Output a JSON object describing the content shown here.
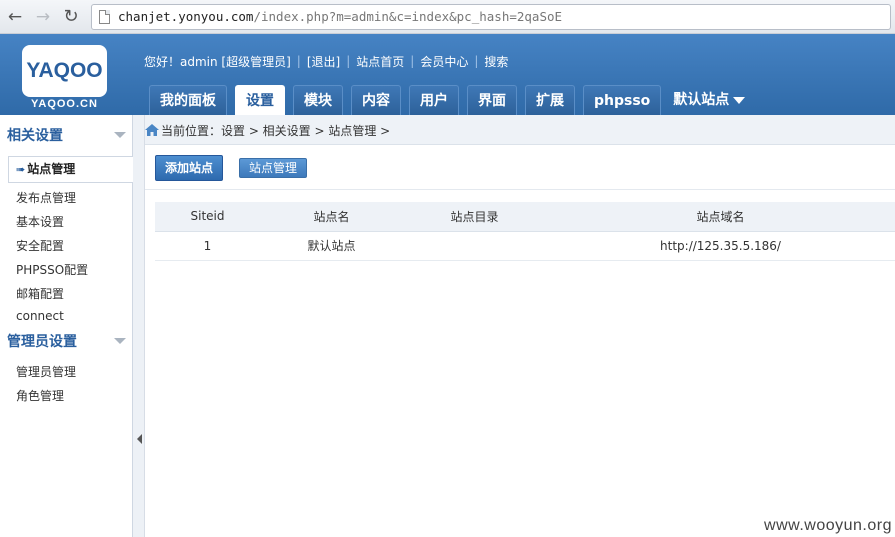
{
  "browser": {
    "url_host": "chanjet.yonyou.com",
    "url_path": "/index.php?m=admin&c=index&pc_hash=2qaSoE"
  },
  "header": {
    "logo_text": "YAQOO",
    "logo_sub": "YAQOO.CN",
    "greeting": "您好！admin [超级管理员]",
    "logout": "[退出]",
    "site_home": "站点首页",
    "member_center": "会员中心",
    "search": "搜索"
  },
  "tabs": [
    {
      "label": "我的面板"
    },
    {
      "label": "设置"
    },
    {
      "label": "模块"
    },
    {
      "label": "内容"
    },
    {
      "label": "用户"
    },
    {
      "label": "界面"
    },
    {
      "label": "扩展"
    },
    {
      "label": "phpsso"
    }
  ],
  "site_switch": "默认站点",
  "sidebar": {
    "group1_title": "相关设置",
    "group1_items": [
      "站点管理",
      "发布点管理",
      "基本设置",
      "安全配置",
      "PHPSSO配置",
      "邮箱配置",
      "connect"
    ],
    "group2_title": "管理员设置",
    "group2_items": [
      "管理员管理",
      "角色管理"
    ]
  },
  "breadcrumb": "当前位置：设置 > 相关设置 > 站点管理 >",
  "actions": {
    "add_site": "添加站点",
    "site_manage": "站点管理"
  },
  "table": {
    "headers": [
      "Siteid",
      "站点名",
      "站点目录",
      "站点域名"
    ],
    "rows": [
      [
        "1",
        "默认站点",
        "",
        "http://125.35.5.186/"
      ]
    ]
  },
  "watermark": "www.wooyun.org",
  "colors": {
    "header_blue": "#3b77b6",
    "accent": "#2a5f9e"
  }
}
